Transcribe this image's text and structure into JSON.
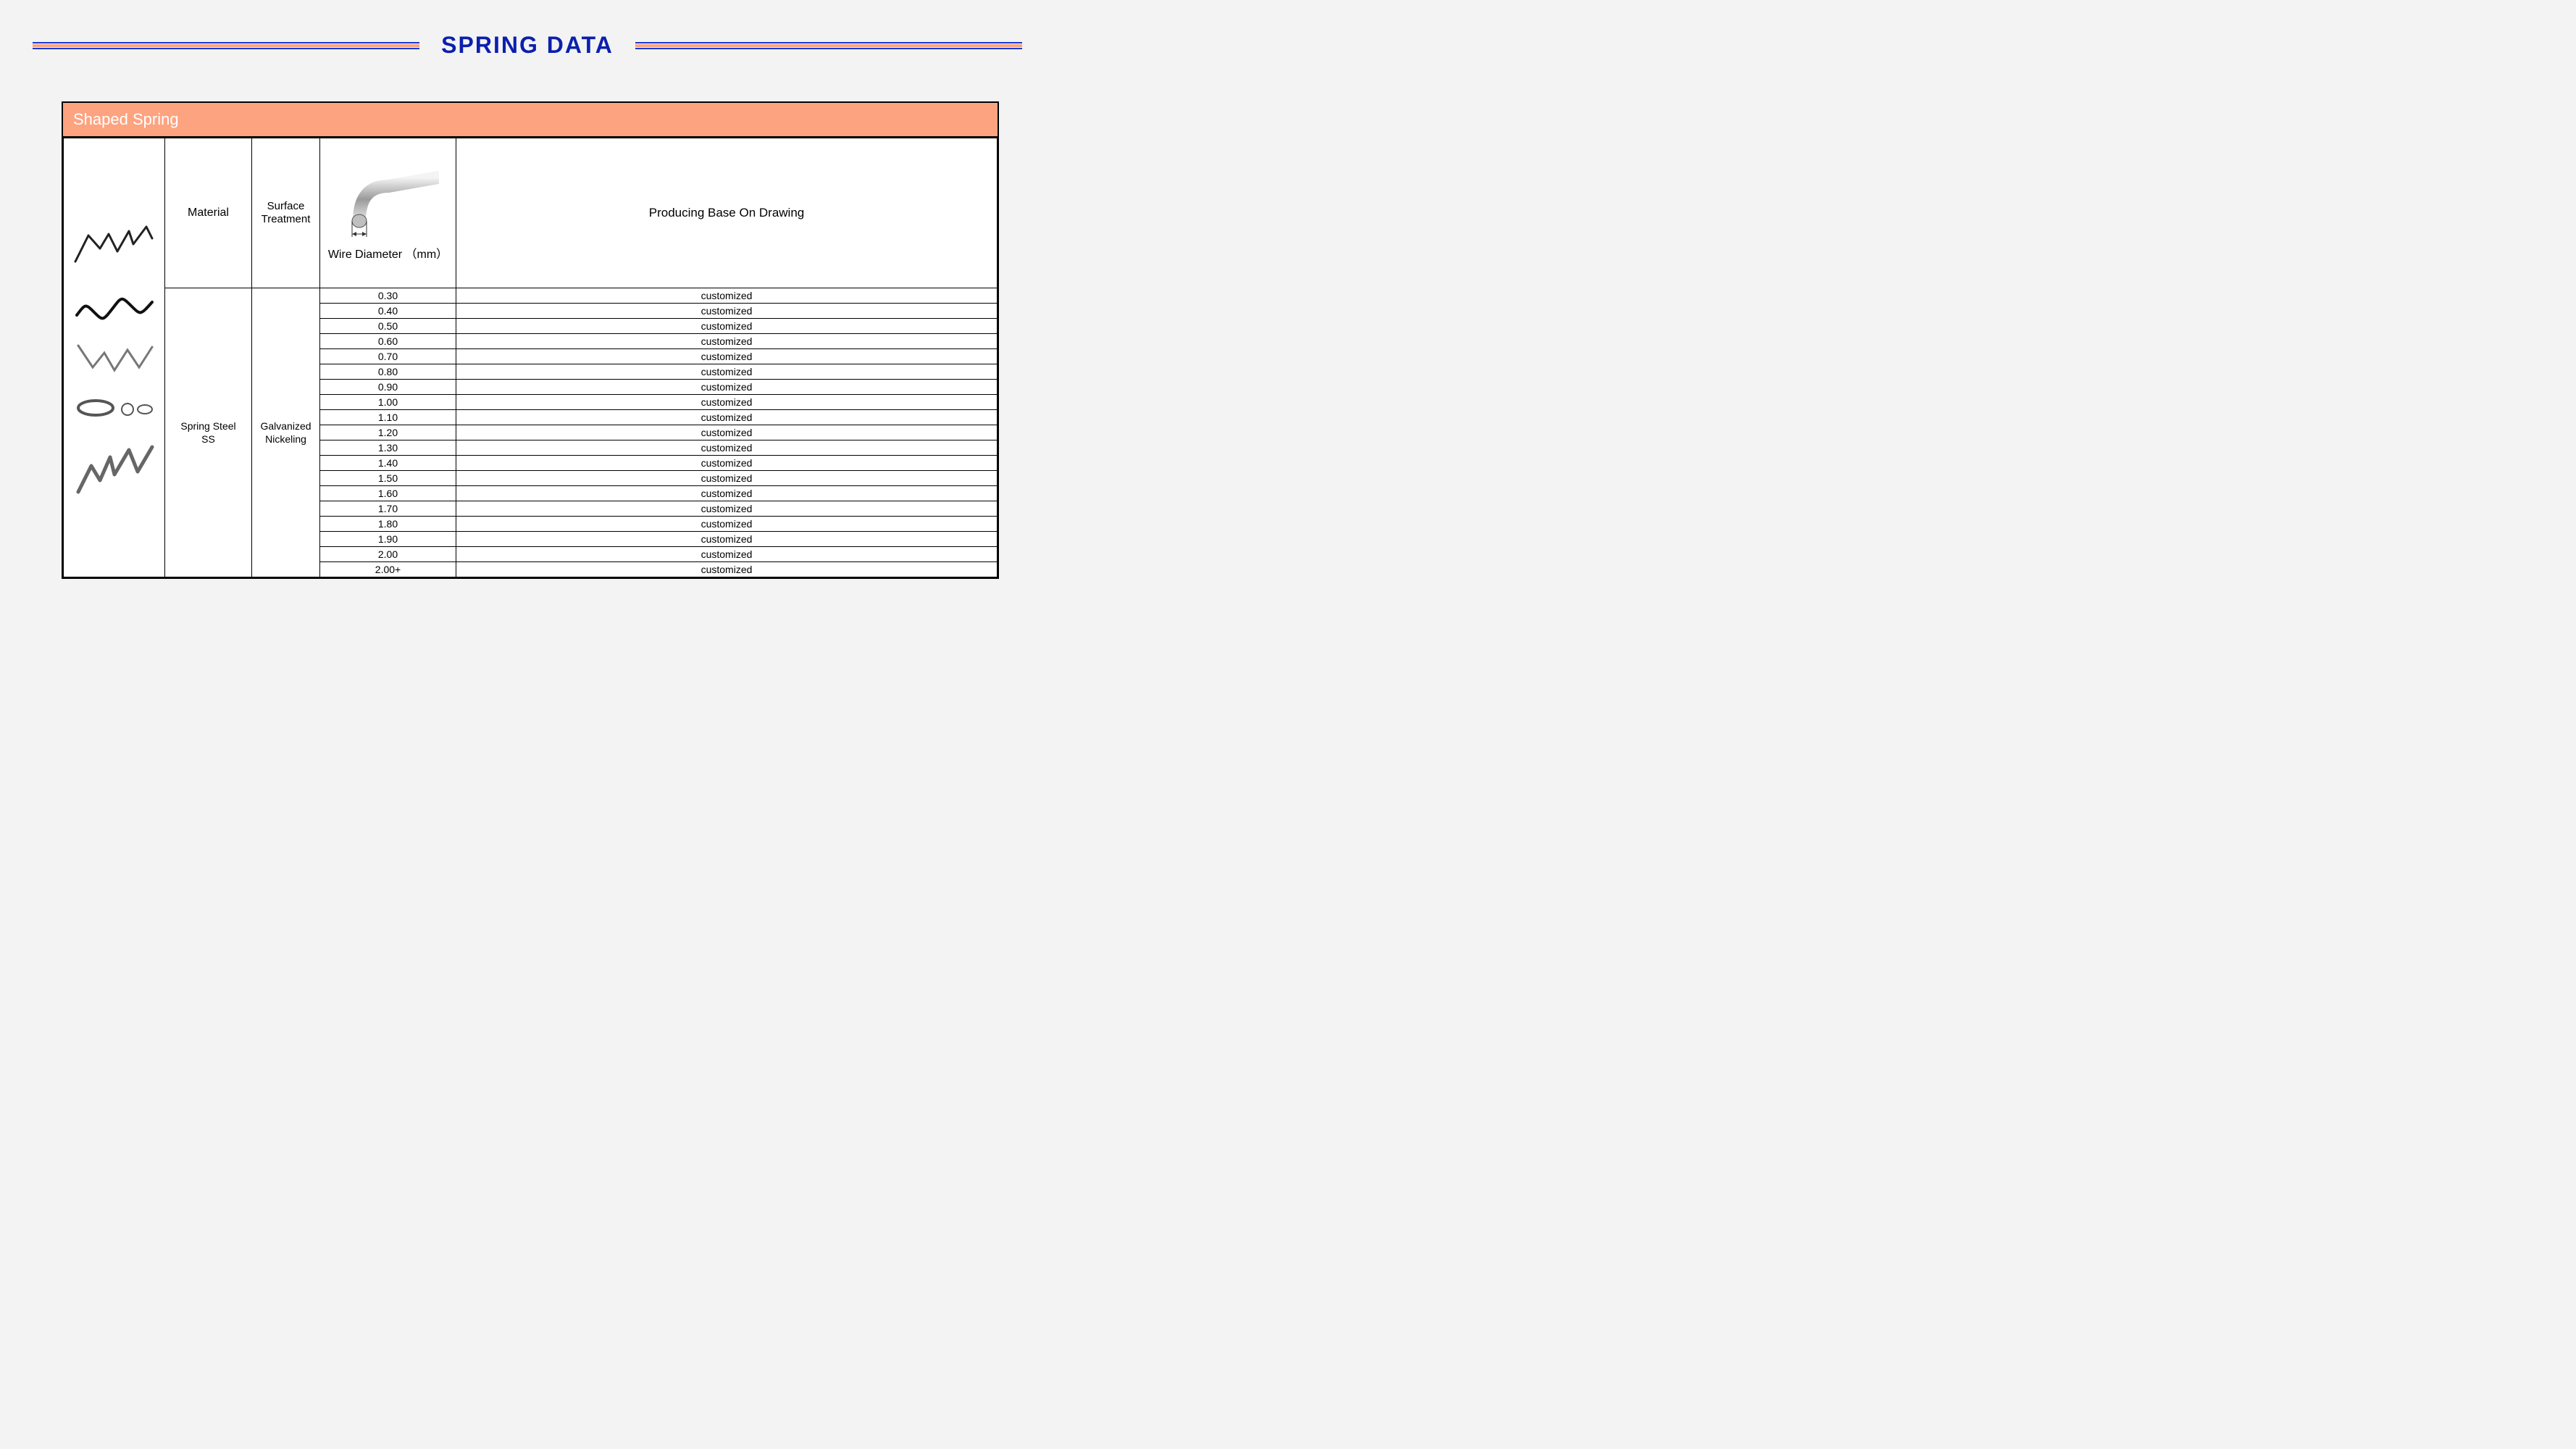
{
  "title": "SPRING  DATA",
  "card_title": "Shaped Spring",
  "headers": {
    "material": "Material",
    "surface": "Surface Treatment",
    "diameter": "Wire Diameter （mm）",
    "producing": "Producing Base On Drawing"
  },
  "material_value": "Spring Steel SS",
  "surface_value": "Galvanized Nickeling",
  "rows": [
    {
      "d": "0.30",
      "v": "customized"
    },
    {
      "d": "0.40",
      "v": "customized"
    },
    {
      "d": "0.50",
      "v": "customized"
    },
    {
      "d": "0.60",
      "v": "customized"
    },
    {
      "d": "0.70",
      "v": "customized"
    },
    {
      "d": "0.80",
      "v": "customized"
    },
    {
      "d": "0.90",
      "v": "customized"
    },
    {
      "d": "1.00",
      "v": "customized"
    },
    {
      "d": "1.10",
      "v": "customized"
    },
    {
      "d": "1.20",
      "v": "customized"
    },
    {
      "d": "1.30",
      "v": "customized"
    },
    {
      "d": "1.40",
      "v": "customized"
    },
    {
      "d": "1.50",
      "v": "customized"
    },
    {
      "d": "1.60",
      "v": "customized"
    },
    {
      "d": "1.70",
      "v": "customized"
    },
    {
      "d": "1.80",
      "v": "customized"
    },
    {
      "d": "1.90",
      "v": "customized"
    },
    {
      "d": "2.00",
      "v": "customized"
    },
    {
      "d": "2.00+",
      "v": "customized"
    }
  ]
}
